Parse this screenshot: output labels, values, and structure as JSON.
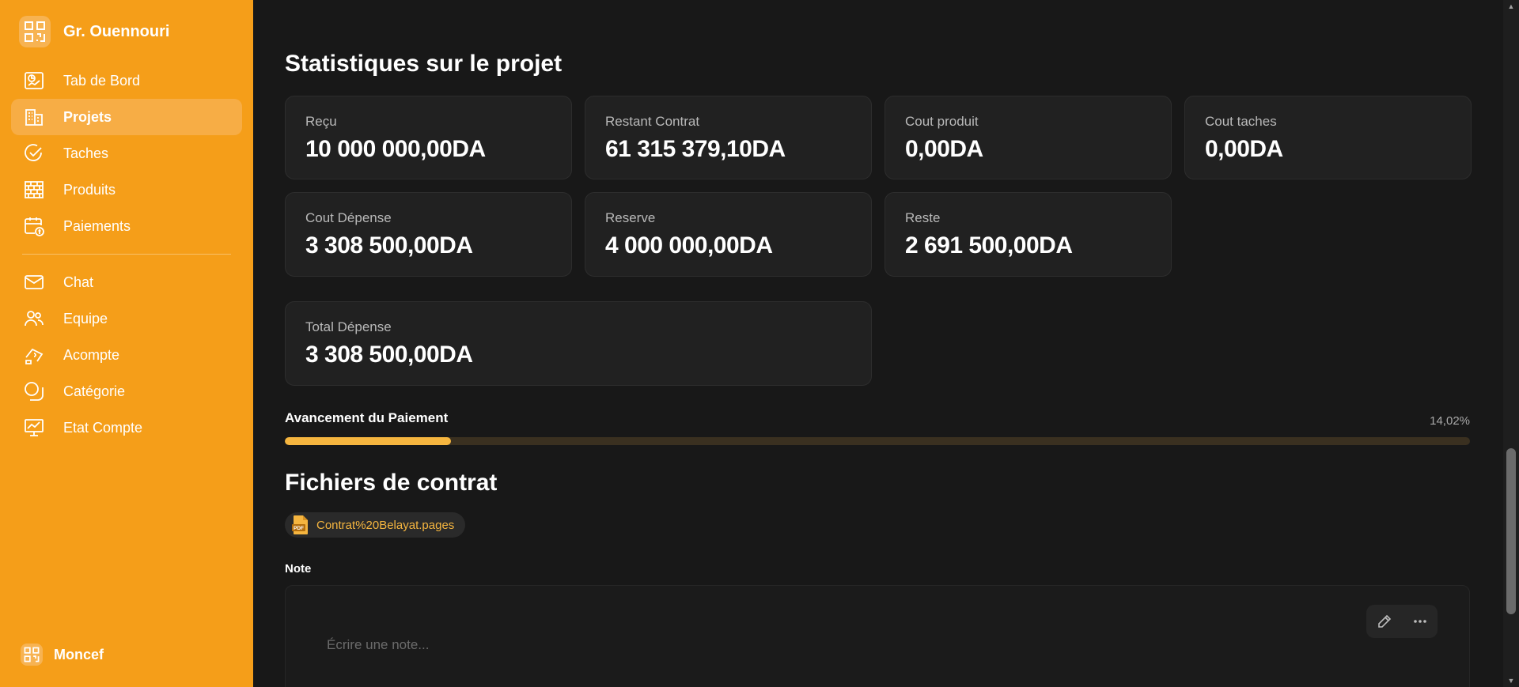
{
  "sidebar": {
    "brand_name": "Gr. Ouennouri",
    "nav_primary": [
      {
        "label": "Tab de Bord",
        "icon": "dashboard-icon",
        "active": false
      },
      {
        "label": "Projets",
        "icon": "building-icon",
        "active": true
      },
      {
        "label": "Taches",
        "icon": "check-circle-icon",
        "active": false
      },
      {
        "label": "Produits",
        "icon": "bricks-icon",
        "active": false
      },
      {
        "label": "Paiements",
        "icon": "calendar-dollar-icon",
        "active": false
      }
    ],
    "nav_secondary": [
      {
        "label": "Chat",
        "icon": "mail-icon"
      },
      {
        "label": "Equipe",
        "icon": "users-icon"
      },
      {
        "label": "Acompte",
        "icon": "hand-money-icon"
      },
      {
        "label": "Catégorie",
        "icon": "category-icon"
      },
      {
        "label": "Etat Compte",
        "icon": "monitor-chart-icon"
      }
    ],
    "user_name": "Moncef"
  },
  "stats": {
    "title": "Statistiques sur le projet",
    "cards": [
      {
        "label": "Reçu",
        "value": "10 000 000,00DA"
      },
      {
        "label": "Restant Contrat",
        "value": "61 315 379,10DA"
      },
      {
        "label": "Cout produit",
        "value": "0,00DA"
      },
      {
        "label": "Cout taches",
        "value": "0,00DA"
      },
      {
        "label": "Cout Dépense",
        "value": "3 308 500,00DA"
      },
      {
        "label": "Reserve",
        "value": "4 000 000,00DA"
      },
      {
        "label": "Reste",
        "value": "2 691 500,00DA"
      },
      {
        "label": "Total Dépense",
        "value": "3 308 500,00DA"
      }
    ]
  },
  "payment_progress": {
    "title": "Avancement du Paiement",
    "percent_label": "14,02%",
    "fraction": 0.1402
  },
  "files": {
    "title": "Fichiers de contrat",
    "items": [
      {
        "name": "Contrat%20Belayat.pages",
        "icon": "pdf-file-icon"
      }
    ]
  },
  "note": {
    "label": "Note",
    "placeholder": "Écrire une note..."
  },
  "colors": {
    "sidebar_bg": "#f59e19",
    "accent": "#f5b53f",
    "background": "#181818",
    "card_bg": "#212121"
  }
}
